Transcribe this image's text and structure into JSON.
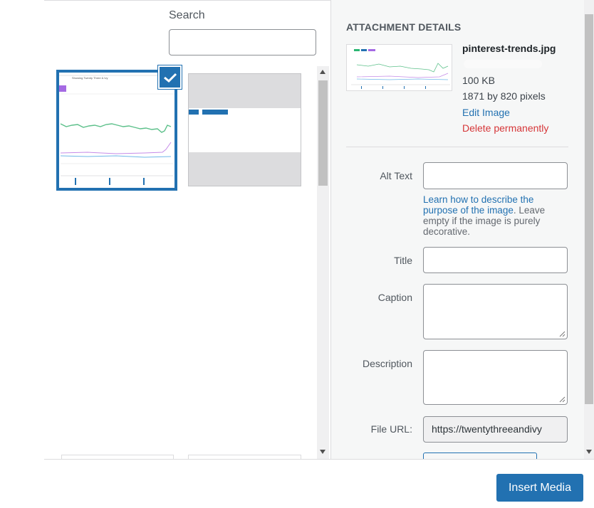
{
  "search": {
    "label": "Search",
    "value": "",
    "placeholder": ""
  },
  "grid": {
    "items": [
      {
        "kind": "chart-thumbnail",
        "selected": true
      },
      {
        "kind": "screenshot-thumbnail",
        "selected": false
      }
    ],
    "check_icon": "checkmark-icon"
  },
  "sidebar": {
    "heading": "ATTACHMENT DETAILS",
    "filename": "pinterest-trends.jpg",
    "filesize": "100 KB",
    "dimensions": "1871 by 820 pixels",
    "edit_link": "Edit Image",
    "delete_link": "Delete permanently",
    "fields": {
      "alt": {
        "label": "Alt Text",
        "value": ""
      },
      "alt_help_link": "Learn how to describe the purpose of the image",
      "alt_help_rest": ". Leave empty if the image is purely decorative.",
      "title": {
        "label": "Title",
        "value": ""
      },
      "caption": {
        "label": "Caption",
        "value": ""
      },
      "description": {
        "label": "Description",
        "value": ""
      },
      "url": {
        "label": "File URL:",
        "value": "https://twentythreeandivy"
      }
    }
  },
  "footer": {
    "insert_label": "Insert Media"
  },
  "colors": {
    "accent": "#2271b1",
    "danger": "#d63638",
    "sidebar_bg": "#f6f7f7"
  }
}
